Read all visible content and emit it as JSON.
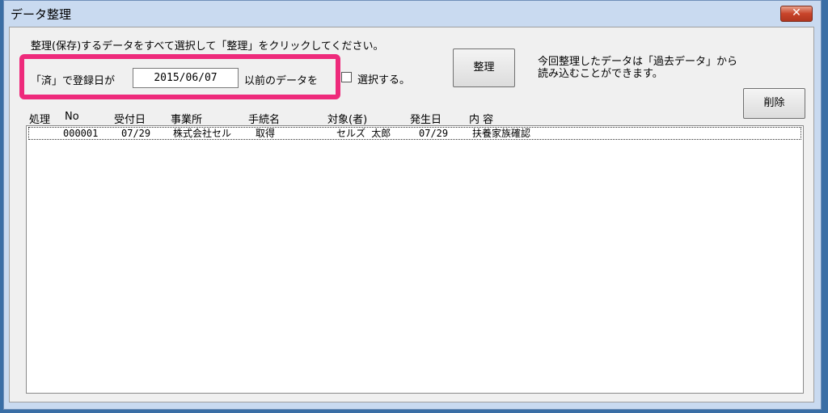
{
  "window": {
    "title": "データ整理",
    "close_label": "✕"
  },
  "instruction": "整理(保存)するデータをすべて選択して「整理」をクリックしてください。",
  "filter": {
    "prefix": "「済」で登録日が",
    "date_value": "2015/06/07",
    "suffix": "以前のデータを",
    "checkbox_label": "選択する。"
  },
  "buttons": {
    "organize": "整理",
    "delete": "削除"
  },
  "info": "今回整理したデータは「過去データ」から\n読み込むことができます。",
  "columns": [
    "処理",
    "No",
    "受付日",
    "事業所",
    "手続名",
    "対象(者)",
    "発生日",
    "内 容"
  ],
  "rows": [
    {
      "process": "",
      "no": "000001",
      "received": "07/29",
      "office": "株式会社セル",
      "procedure": "取得",
      "target": "セルズ 太郎",
      "occurred": "07/29",
      "content": "扶養家族確認"
    }
  ]
}
